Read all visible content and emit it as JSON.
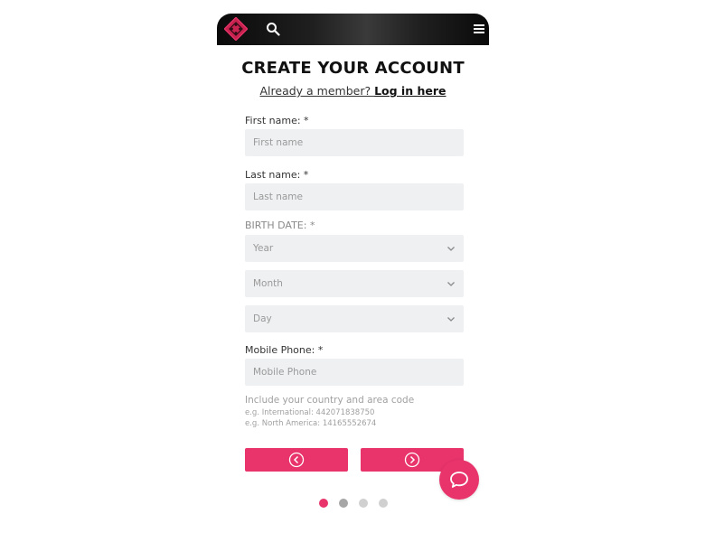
{
  "header": {
    "logo_icon": "diamond-logo-icon",
    "search_icon": "search-icon",
    "menu_icon": "hamburger-menu-icon"
  },
  "page": {
    "title": "CREATE YOUR ACCOUNT",
    "already_member": "Already a member? ",
    "login_link": "Log in here"
  },
  "form": {
    "first_name": {
      "label": "First name: *",
      "placeholder": "First name"
    },
    "last_name": {
      "label": "Last name: *",
      "placeholder": "Last name"
    },
    "birth_date": {
      "label": "BIRTH DATE: *",
      "year": "Year",
      "month": "Month",
      "day": "Day"
    },
    "mobile_phone": {
      "label": "Mobile Phone: *",
      "placeholder": "Mobile Phone",
      "hint": "Include your country and area code",
      "example_international": "e.g. International: 442071838750",
      "example_north_america": "e.g. North America: 14165552674"
    }
  },
  "navigation": {
    "prev_icon": "chevron-left-circle-icon",
    "next_icon": "chevron-right-circle-icon",
    "steps_total": 4,
    "current_step": 1
  },
  "chat": {
    "icon": "chat-bubble-icon"
  },
  "colors": {
    "accent": "#e8336b",
    "field_bg": "#eef0f2",
    "header_bg": "#1a1a1a"
  }
}
